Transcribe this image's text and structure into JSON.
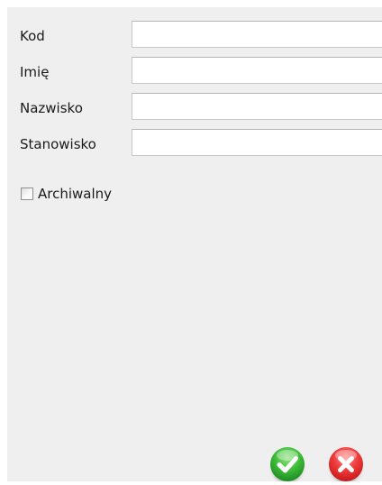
{
  "form": {
    "fields": [
      {
        "label": "Kod",
        "value": "",
        "placeholder": ""
      },
      {
        "label": "Imię",
        "value": "",
        "placeholder": ""
      },
      {
        "label": "Nazwisko",
        "value": "",
        "placeholder": ""
      },
      {
        "label": "Stanowisko",
        "value": "",
        "placeholder": ""
      }
    ],
    "archive_checkbox": {
      "label": "Archiwalny",
      "checked": false
    }
  },
  "actions": {
    "ok": {
      "icon": "checkmark-icon",
      "color": "#2fa82f"
    },
    "cancel": {
      "icon": "close-icon",
      "color": "#e02828"
    }
  }
}
